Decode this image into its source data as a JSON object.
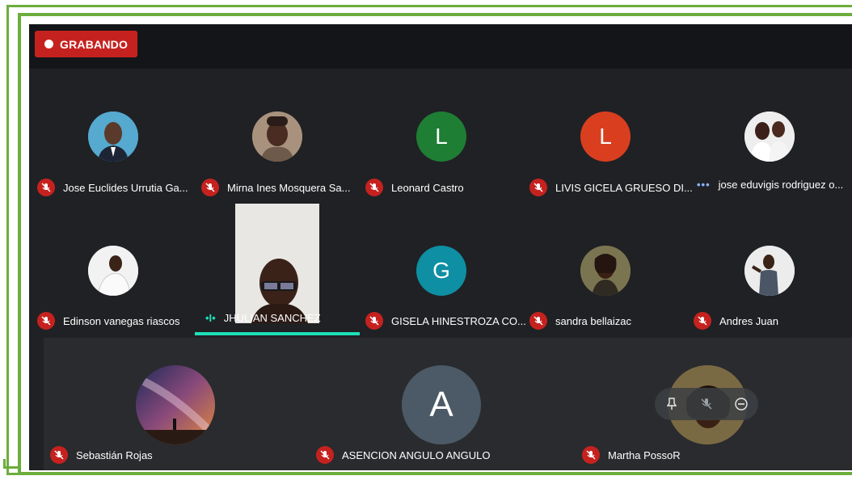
{
  "recording": {
    "label": "GRABANDO"
  },
  "colors": {
    "frame": "#6cad3c",
    "bg": "#202124",
    "mic_off": "#c5221f",
    "speaking": "#1ee0b8"
  },
  "participants": [
    {
      "name": "Jose Euclides Urrutia Ga...",
      "avatar": "photo",
      "mic": "off"
    },
    {
      "name": "Mirna Ines Mosquera Sa...",
      "avatar": "photo",
      "mic": "off"
    },
    {
      "name": "Leonard Castro",
      "avatar": "L",
      "avatar_color": "#1e7e34",
      "mic": "off"
    },
    {
      "name": "LIVIS GICELA GRUESO DI...",
      "avatar": "L",
      "avatar_color": "#d93f1f",
      "mic": "off"
    },
    {
      "name": "jose eduvigis rodriguez o...",
      "avatar": "photo",
      "mic": "more"
    },
    {
      "name": "Edinson vanegas riascos",
      "avatar": "photo",
      "mic": "off"
    },
    {
      "name": "JHULIAN SANCHEZ",
      "avatar": "video",
      "mic": "speaking"
    },
    {
      "name": "GISELA HINESTROZA CO...",
      "avatar": "G",
      "avatar_color": "#0e8fa3",
      "mic": "off"
    },
    {
      "name": "sandra bellaizac",
      "avatar": "photo",
      "mic": "off"
    },
    {
      "name": "Andres Juan",
      "avatar": "photo",
      "mic": "off"
    },
    {
      "name": "Sebastián Rojas",
      "avatar": "photo",
      "mic": "off"
    },
    {
      "name": "ASENCION ANGULO ANGULO",
      "avatar": "A",
      "avatar_color": "#4b5a66",
      "mic": "off"
    },
    {
      "name": "Martha PossoR",
      "avatar": "photo",
      "mic": "off"
    }
  ],
  "hover_controls": [
    "pin-icon",
    "mute-icon",
    "remove-icon"
  ]
}
